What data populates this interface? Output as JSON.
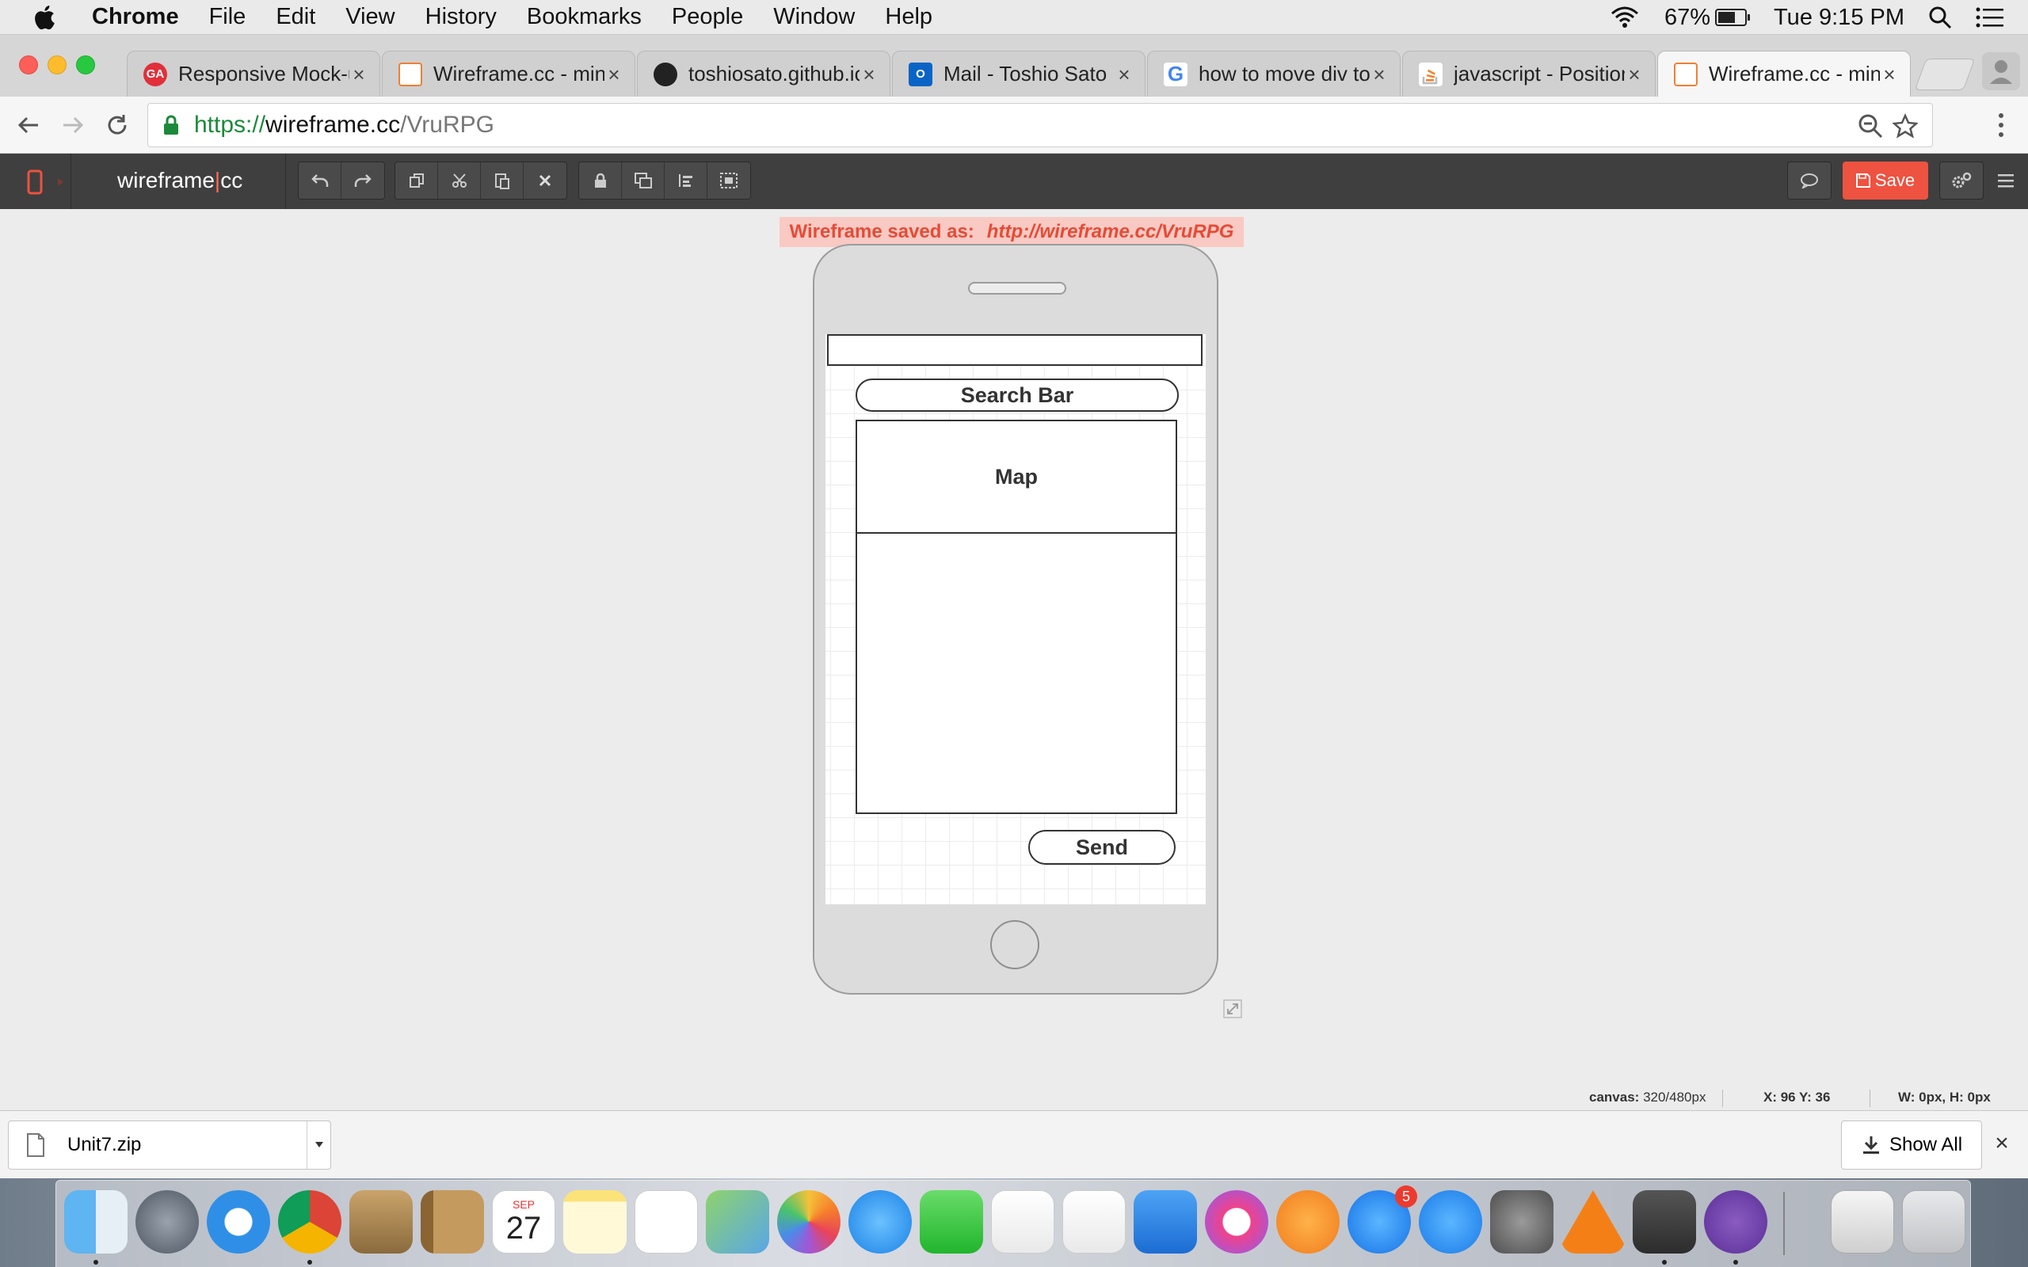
{
  "menubar": {
    "app_name": "Chrome",
    "menus": [
      "File",
      "Edit",
      "View",
      "History",
      "Bookmarks",
      "People",
      "Window",
      "Help"
    ],
    "battery_percent": "67%",
    "battery_level": 0.67,
    "clock": "Tue 9:15 PM"
  },
  "tabs": [
    {
      "title": "Responsive Mock-up",
      "favicon": "ga-icon",
      "favicon_text": "GA",
      "favicon_color": "#e0303a"
    },
    {
      "title": "Wireframe.cc - minimal",
      "favicon": "wireframe-icon",
      "favicon_text": "",
      "favicon_color": "#f07f34"
    },
    {
      "title": "toshiosato.github.io",
      "favicon": "github-icon",
      "favicon_text": "",
      "favicon_color": "#222222"
    },
    {
      "title": "Mail - Toshio Sato",
      "favicon": "outlook-icon",
      "favicon_text": "O",
      "favicon_color": "#0a64c6"
    },
    {
      "title": "how to move div to",
      "favicon": "google-icon",
      "favicon_text": "G",
      "favicon_color": "#ffffff"
    },
    {
      "title": "javascript - Position",
      "favicon": "stackoverflow-icon",
      "favicon_text": "",
      "favicon_color": "#f48024"
    },
    {
      "title": "Wireframe.cc - minimal",
      "favicon": "wireframe-icon",
      "favicon_text": "",
      "favicon_color": "#f07f34"
    }
  ],
  "active_tab_index": 6,
  "address": {
    "scheme": "https://",
    "host": "wireframe.cc",
    "path": "/VruRPG"
  },
  "app": {
    "brand_left": "wireframe",
    "brand_sep": "|",
    "brand_right": "cc",
    "save_label": "Save",
    "accent": "#ee5240"
  },
  "banner": {
    "label": "Wireframe saved as:",
    "link": "http://wireframe.cc/VruRPG"
  },
  "wireframe": {
    "search_bar": "Search Bar",
    "map": "Map",
    "send": "Send"
  },
  "status": {
    "canvas_label": "canvas:",
    "canvas_value": "320/480px",
    "xy": "X: 96 Y: 36",
    "wh": "W: 0px, H: 0px"
  },
  "downloads": {
    "file": "Unit7.zip",
    "show_all": "Show All"
  },
  "dock": {
    "calendar_month": "SEP",
    "calendar_day": "27",
    "appstore_badge": "5"
  }
}
